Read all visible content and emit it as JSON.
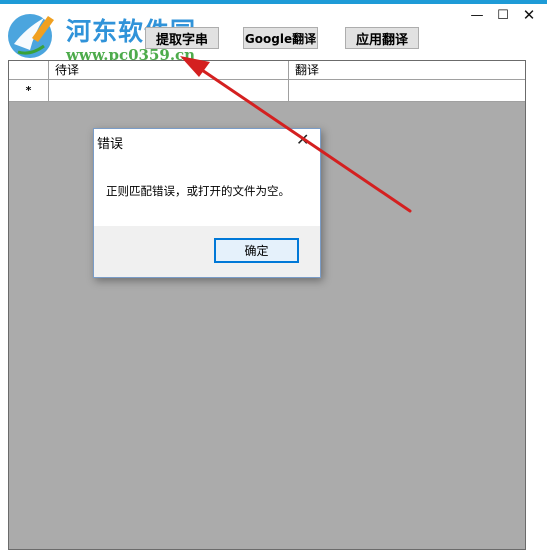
{
  "window": {
    "accent_color": "#1e9bd7",
    "minimize_glyph": "—",
    "maximize_glyph": "☐",
    "close_glyph": "✕"
  },
  "watermark": {
    "site_name": "河东软件园",
    "url": "www.pc0359.cn"
  },
  "toolbar": {
    "extract_label": "提取字串",
    "google_label": "Google翻译",
    "apply_label": "应用翻译"
  },
  "grid": {
    "columns": [
      "",
      "待译",
      "翻译"
    ],
    "new_row_marker": "*",
    "background_color": "#ababab"
  },
  "dialog": {
    "title": "错误",
    "close_glyph": "✕",
    "message": "正则匹配错误，或打开的文件为空。",
    "ok_label": "确定"
  },
  "annotation": {
    "arrow_color": "#d42020"
  }
}
